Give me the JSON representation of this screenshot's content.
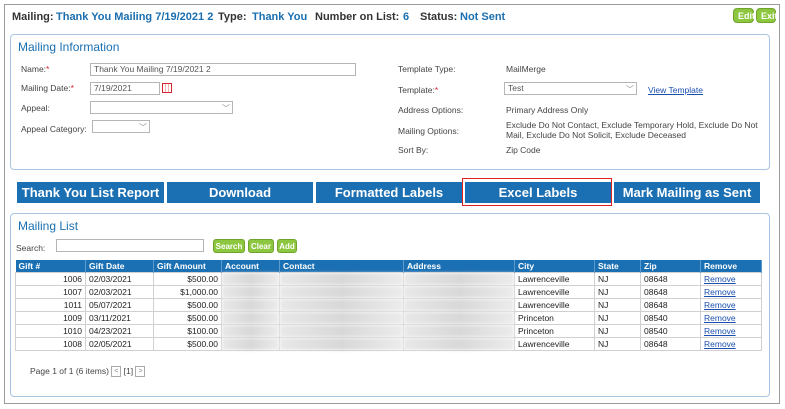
{
  "header": {
    "mailing_label": "Mailing:",
    "mailing_value": "Thank You Mailing 7/19/2021 2",
    "type_label": "Type:",
    "type_value": "Thank You",
    "number_label": "Number on List:",
    "number_value": "6",
    "status_label": "Status:",
    "status_value": "Not Sent",
    "edit_label": "Edit",
    "exit_label": "Exit"
  },
  "info": {
    "title": "Mailing Information",
    "name_label": "Name:",
    "name_value": "Thank You Mailing 7/19/2021 2",
    "date_label": "Mailing Date:",
    "date_value": "7/19/2021",
    "appeal_label": "Appeal:",
    "appeal_value": "",
    "appeal_category_label": "Appeal Category:",
    "appeal_category_value": "",
    "template_type_label": "Template Type:",
    "template_type_value": "MailMerge",
    "template_label": "Template:",
    "template_value": "Test",
    "view_template_label": "View Template",
    "address_options_label": "Address Options:",
    "address_options_value": "Primary Address Only",
    "mailing_options_label": "Mailing Options:",
    "mailing_options_value": "Exclude Do Not Contact, Exclude Temporary Hold, Exclude Do Not Mail, Exclude Do Not Solicit, Exclude Deceased",
    "sort_by_label": "Sort By:",
    "sort_by_value": "Zip Code",
    "required_mark": "*"
  },
  "actions": {
    "thank_you_report": "Thank You List Report",
    "download": "Download",
    "formatted_labels": "Formatted Labels",
    "excel_labels": "Excel Labels",
    "mark_sent": "Mark Mailing as Sent"
  },
  "list": {
    "title": "Mailing List",
    "search_label": "Search:",
    "search_value": "",
    "search_button": "Search",
    "clear_button": "Clear",
    "add_button": "Add",
    "columns": [
      "Gift #",
      "Gift Date",
      "Gift Amount",
      "Account",
      "Contact",
      "Address",
      "City",
      "State",
      "Zip",
      "Remove"
    ],
    "rows": [
      {
        "gift": "1006",
        "date": "02/03/2021",
        "amount": "$500.00",
        "city": "Lawrenceville",
        "state": "NJ",
        "zip": "08648",
        "remove": "Remove"
      },
      {
        "gift": "1007",
        "date": "02/03/2021",
        "amount": "$1,000.00",
        "city": "Lawrenceville",
        "state": "NJ",
        "zip": "08648",
        "remove": "Remove"
      },
      {
        "gift": "1011",
        "date": "05/07/2021",
        "amount": "$500.00",
        "city": "Lawrenceville",
        "state": "NJ",
        "zip": "08648",
        "remove": "Remove"
      },
      {
        "gift": "1009",
        "date": "03/11/2021",
        "amount": "$500.00",
        "city": "Princeton",
        "state": "NJ",
        "zip": "08540",
        "remove": "Remove"
      },
      {
        "gift": "1010",
        "date": "04/23/2021",
        "amount": "$100.00",
        "city": "Princeton",
        "state": "NJ",
        "zip": "08540",
        "remove": "Remove"
      },
      {
        "gift": "1008",
        "date": "02/05/2021",
        "amount": "$500.00",
        "city": "Lawrenceville",
        "state": "NJ",
        "zip": "08648",
        "remove": "Remove"
      }
    ],
    "pager_text": "Page 1 of 1 (6 items)",
    "pager_prev": "<",
    "pager_current": "[1]",
    "pager_next": ">"
  },
  "colors": {
    "accent_blue": "#1b6fb3",
    "button_green": "#8dc63f",
    "highlight_red": "#e02020"
  }
}
